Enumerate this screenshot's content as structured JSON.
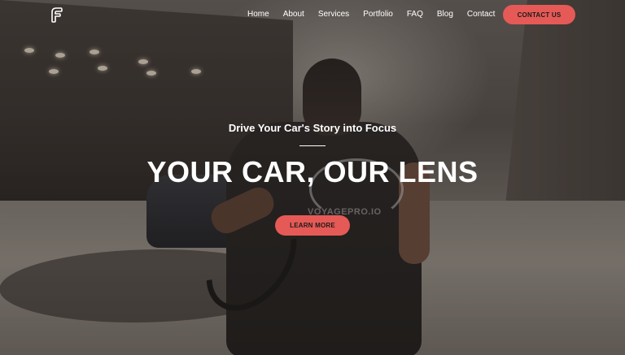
{
  "header": {
    "logo_icon": "f-logo-icon",
    "nav": [
      {
        "label": "Home"
      },
      {
        "label": "About"
      },
      {
        "label": "Services"
      },
      {
        "label": "Portfolio"
      },
      {
        "label": "FAQ"
      },
      {
        "label": "Blog"
      },
      {
        "label": "Contact"
      }
    ],
    "contact_button": "CONTACT US"
  },
  "hero": {
    "subtitle": "Drive Your Car's Story into Focus",
    "title": "YOUR CAR, OUR LENS",
    "cta_button": "LEARN MORE",
    "shirt_text": "VOYAGEPRO.IO"
  },
  "colors": {
    "accent": "#e55a56",
    "text": "#ffffff"
  }
}
